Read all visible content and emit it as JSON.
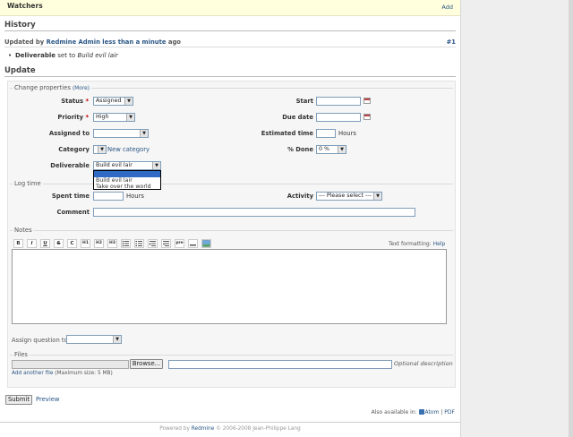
{
  "watchers": {
    "title": "Watchers",
    "add_link": "Add"
  },
  "history": {
    "heading": "History",
    "journal": {
      "prefix": "Updated by",
      "author": "Redmine Admin",
      "time": "less than a minute",
      "suffix": "ago",
      "number": "#1",
      "detail_field": "Deliverable",
      "detail_text": "set to",
      "detail_value": "Build evil lair"
    }
  },
  "update": {
    "heading": "Update",
    "change_properties": {
      "legend": "Change properties",
      "more_link": "(More)",
      "status": {
        "label": "Status",
        "value": "Assigned"
      },
      "priority": {
        "label": "Priority",
        "value": "High"
      },
      "assigned_to": {
        "label": "Assigned to",
        "value": ""
      },
      "category": {
        "label": "Category",
        "value": "",
        "new_link": "New category"
      },
      "deliverable": {
        "label": "Deliverable",
        "value": "Build evil lair",
        "options": [
          "",
          "Build evil lair",
          "Take over the world"
        ]
      },
      "start": {
        "label": "Start",
        "value": ""
      },
      "due_date": {
        "label": "Due date",
        "value": ""
      },
      "estimated_time": {
        "label": "Estimated time",
        "value": "",
        "unit": "Hours"
      },
      "done": {
        "label": "% Done",
        "value": "0 %"
      }
    },
    "log_time": {
      "legend": "Log time",
      "spent_time": {
        "label": "Spent time",
        "value": "",
        "unit": "Hours"
      },
      "activity": {
        "label": "Activity",
        "value": "--- Please select ---"
      },
      "comment": {
        "label": "Comment",
        "value": ""
      }
    },
    "notes": {
      "legend": "Notes",
      "toolbar": [
        "B",
        "I",
        "U",
        "S",
        "C",
        "H1",
        "H2",
        "H3",
        "ul-icon",
        "ol-icon",
        "quote-icon",
        "unquote-icon",
        "pre",
        "link-icon",
        "image-icon"
      ],
      "text_formatting_label": "Text formatting:",
      "help_link": "Help"
    },
    "assign_question": {
      "label": "Assign question to",
      "value": ""
    },
    "files": {
      "legend": "Files",
      "browse_label": "Browse...",
      "description_placeholder": "Optional description",
      "add_another_link": "Add another file",
      "max_size": "(Maximum size: 5 MB)"
    }
  },
  "actions": {
    "submit_label": "Submit",
    "preview_link": "Preview"
  },
  "also_available": {
    "label": "Also available in:",
    "atom": "Atom",
    "separator": "|",
    "pdf": "PDF"
  },
  "footer": {
    "powered_by": "Powered by",
    "redmine": "Redmine",
    "copyright": "© 2006-2008 Jean-Philippe Lang"
  }
}
